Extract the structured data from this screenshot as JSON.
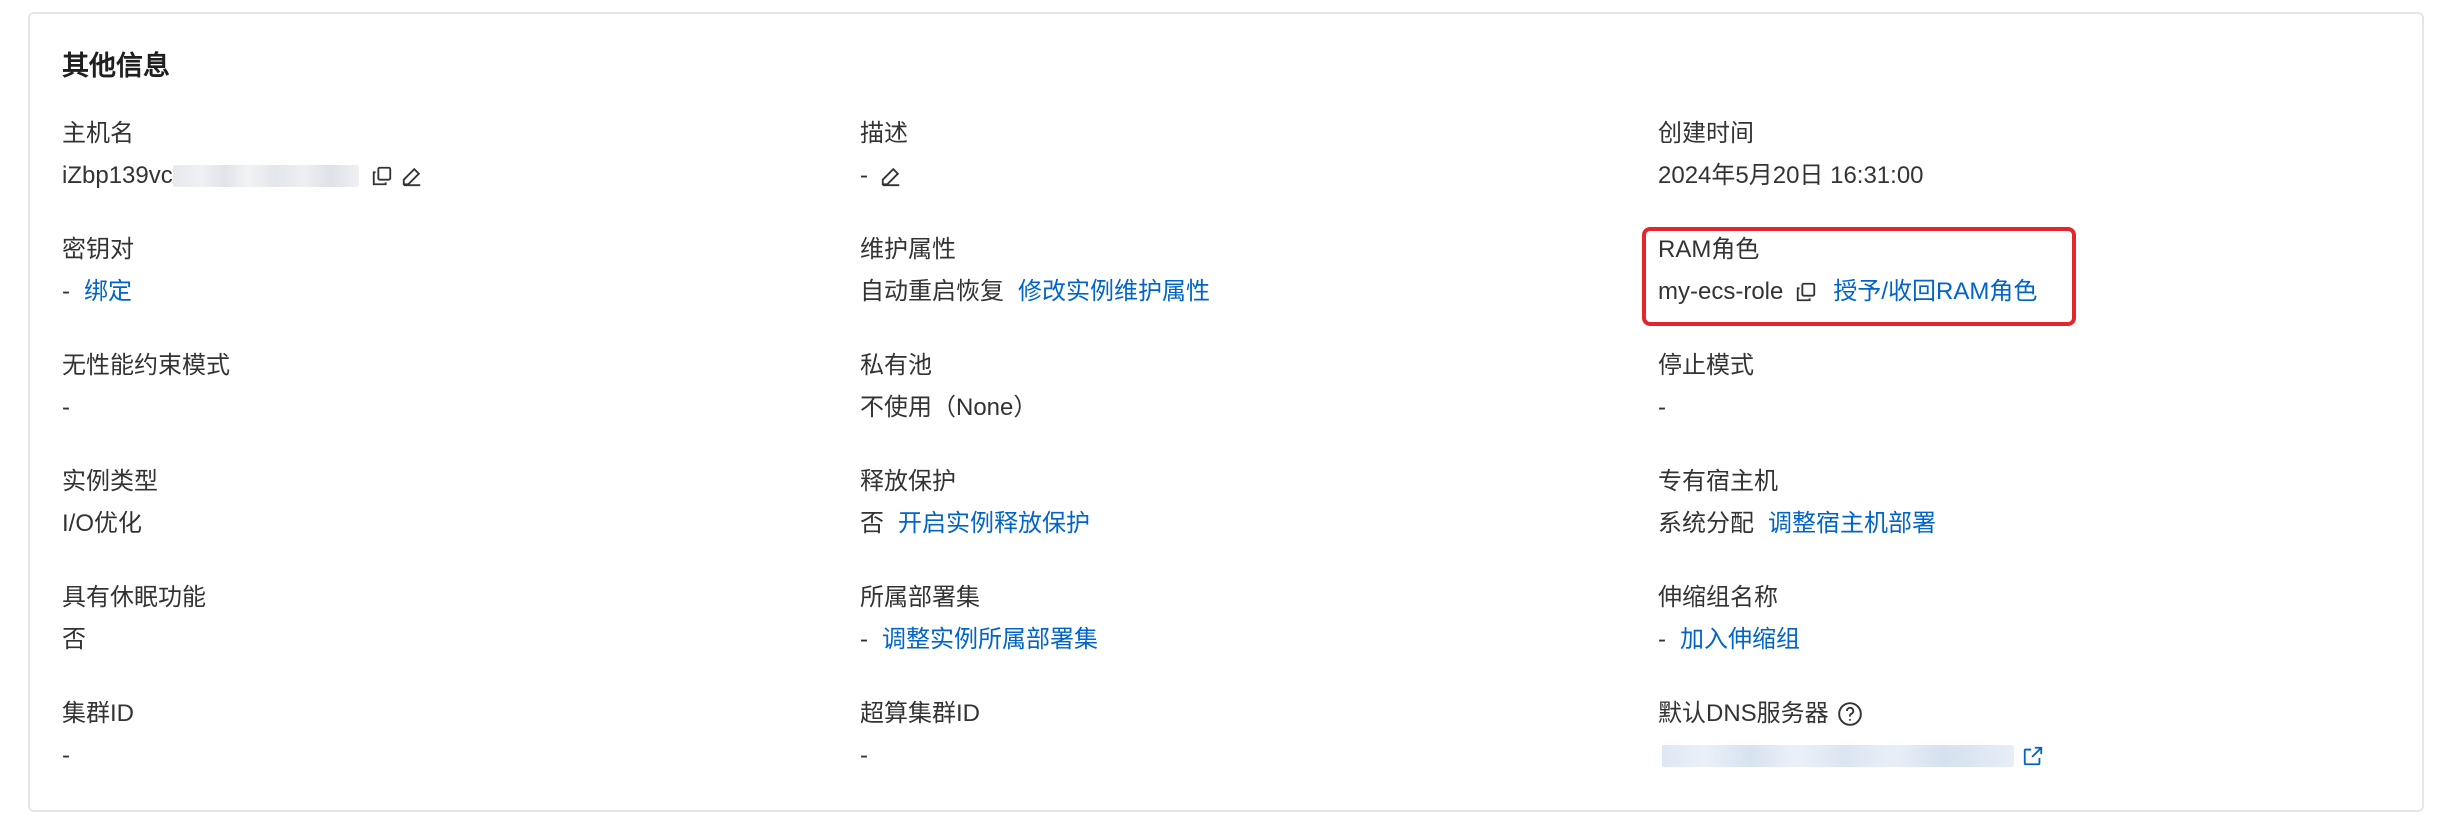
{
  "section_title": "其他信息",
  "fields": {
    "hostname": {
      "label": "主机名",
      "value_prefix": "iZbp139vc"
    },
    "description": {
      "label": "描述",
      "value": "-"
    },
    "created_time": {
      "label": "创建时间",
      "value": "2024年5月20日 16:31:00"
    },
    "key_pair": {
      "label": "密钥对",
      "value": "-",
      "action": "绑定"
    },
    "maintenance": {
      "label": "维护属性",
      "value": "自动重启恢复",
      "action": "修改实例维护属性"
    },
    "ram_role": {
      "label": "RAM角色",
      "value": "my-ecs-role",
      "action": "授予/收回RAM角色"
    },
    "no_perf_constraint": {
      "label": "无性能约束模式",
      "value": "-"
    },
    "private_pool": {
      "label": "私有池",
      "value": "不使用（None）"
    },
    "stop_mode": {
      "label": "停止模式",
      "value": "-"
    },
    "instance_type": {
      "label": "实例类型",
      "value": "I/O优化"
    },
    "release_protection": {
      "label": "释放保护",
      "value": "否",
      "action": "开启实例释放保护"
    },
    "dedicated_host": {
      "label": "专有宿主机",
      "value": "系统分配",
      "action": "调整宿主机部署"
    },
    "hibernation": {
      "label": "具有休眠功能",
      "value": "否"
    },
    "deployment_set": {
      "label": "所属部署集",
      "value": "-",
      "action": "调整实例所属部署集"
    },
    "scaling_group": {
      "label": "伸缩组名称",
      "value": "-",
      "action": "加入伸缩组"
    },
    "cluster_id": {
      "label": "集群ID",
      "value": "-"
    },
    "supercomputing_cluster_id": {
      "label": "超算集群ID",
      "value": "-"
    },
    "default_dns": {
      "label": "默认DNS服务器"
    }
  },
  "icons": {
    "copy": "copy-icon",
    "edit": "edit-icon",
    "help": "question-circle-icon",
    "external": "external-link-icon"
  },
  "colors": {
    "link": "#0064c8",
    "highlight": "#e3262b",
    "text": "#333333"
  }
}
